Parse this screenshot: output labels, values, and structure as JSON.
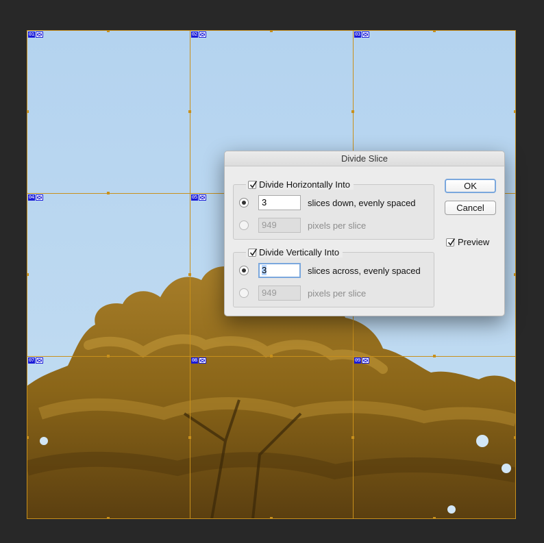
{
  "slices": [
    "01",
    "02",
    "03",
    "04",
    "05",
    "06",
    "07",
    "08",
    "09"
  ],
  "colors": {
    "slice_line": "#c8901c",
    "slice_badge": "#1a1ad8",
    "sky": "#b4d2ee"
  },
  "dialog": {
    "title": "Divide Slice",
    "horizontal": {
      "label": "Divide Horizontally Into",
      "checked": true,
      "count_value": "3",
      "count_label": "slices down, evenly spaced",
      "pixels_value": "949",
      "pixels_label": "pixels per slice"
    },
    "vertical": {
      "label": "Divide Vertically Into",
      "checked": true,
      "count_value": "3",
      "count_label": "slices across, evenly spaced",
      "pixels_value": "949",
      "pixels_label": "pixels per slice"
    },
    "ok_label": "OK",
    "cancel_label": "Cancel",
    "preview_label": "Preview",
    "preview_checked": true
  }
}
